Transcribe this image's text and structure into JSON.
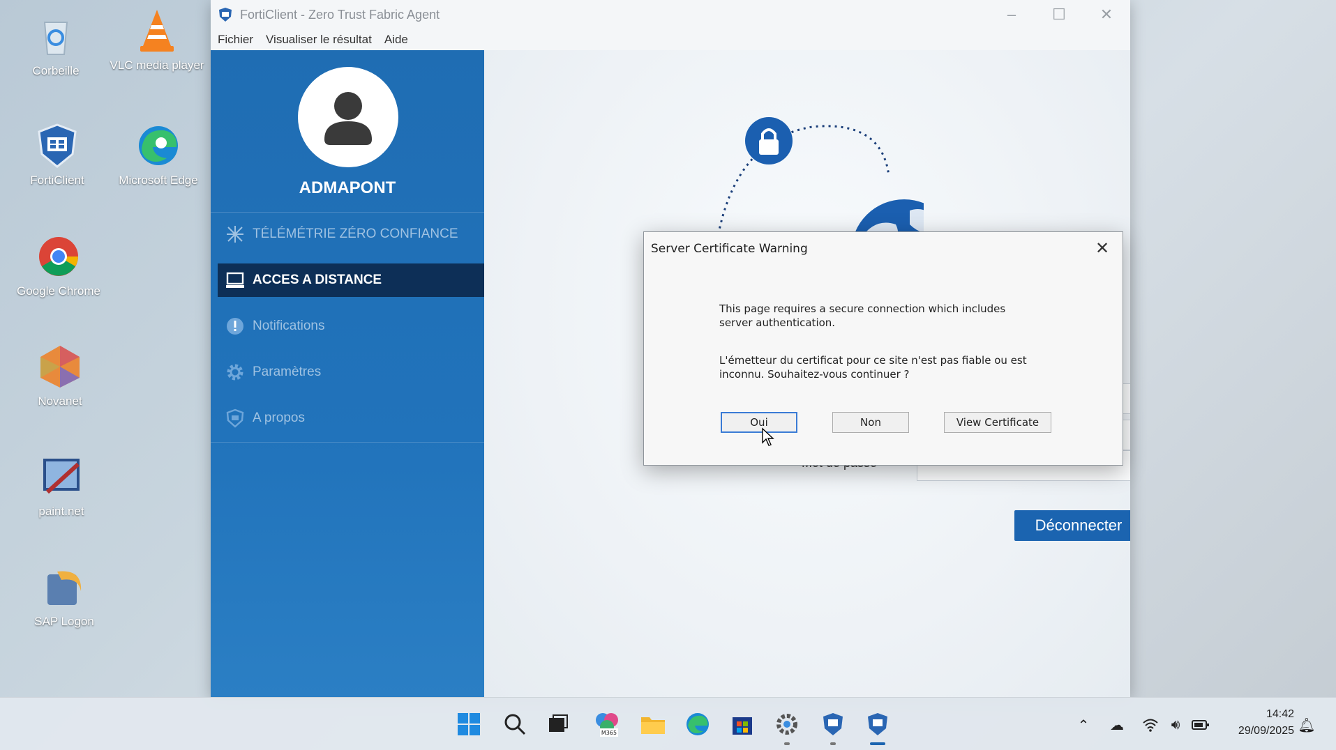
{
  "desktop": {
    "icons": [
      {
        "label": "Corbeille",
        "icon": "recycle-bin-icon"
      },
      {
        "label": "VLC media player",
        "icon": "vlc-icon"
      },
      {
        "label": "FortiClient",
        "icon": "forticlient-icon"
      },
      {
        "label": "Microsoft Edge",
        "icon": "edge-icon"
      },
      {
        "label": "Google Chrome",
        "icon": "chrome-icon"
      },
      {
        "label": "Novanet",
        "icon": "novanet-icon"
      },
      {
        "label": "paint.net",
        "icon": "paintnet-icon"
      },
      {
        "label": "SAP Logon",
        "icon": "sap-logon-icon"
      }
    ]
  },
  "window": {
    "title": "FortiClient - Zero Trust Fabric Agent",
    "menu": [
      "Fichier",
      "Visualiser le résultat",
      "Aide"
    ]
  },
  "sidebar": {
    "username": "ADMAPONT",
    "items": [
      {
        "label": "TÉLÉMÉTRIE ZÉRO CONFIANCE",
        "icon": "telemetry-icon"
      },
      {
        "label": "ACCES A DISTANCE",
        "icon": "remote-access-icon",
        "active": true
      },
      {
        "label": "Notifications",
        "icon": "notification-icon"
      },
      {
        "label": "Paramètres",
        "icon": "gear-icon"
      },
      {
        "label": "A propos",
        "icon": "shield-icon"
      }
    ]
  },
  "main": {
    "password_label": "Mot de passe",
    "disconnect_label": "Déconnecter"
  },
  "dialog": {
    "title": "Server Certificate Warning",
    "message1_line1": "This page requires a secure connection which includes",
    "message1_line2": "server authentication.",
    "message2_line1": "L'émetteur du certificat pour ce site n'est pas fiable ou est",
    "message2_line2": "inconnu. Souhaitez-vous continuer ?",
    "yes_label": "Oui",
    "no_label": "Non",
    "view_cert_label": "View Certificate"
  },
  "taskbar": {
    "time": "14:42",
    "date": "29/09/2025",
    "m365_label": "M365"
  },
  "colors": {
    "brand_blue": "#1f6db3",
    "active_nav": "#0d2f57",
    "button_blue": "#1b64b0"
  }
}
